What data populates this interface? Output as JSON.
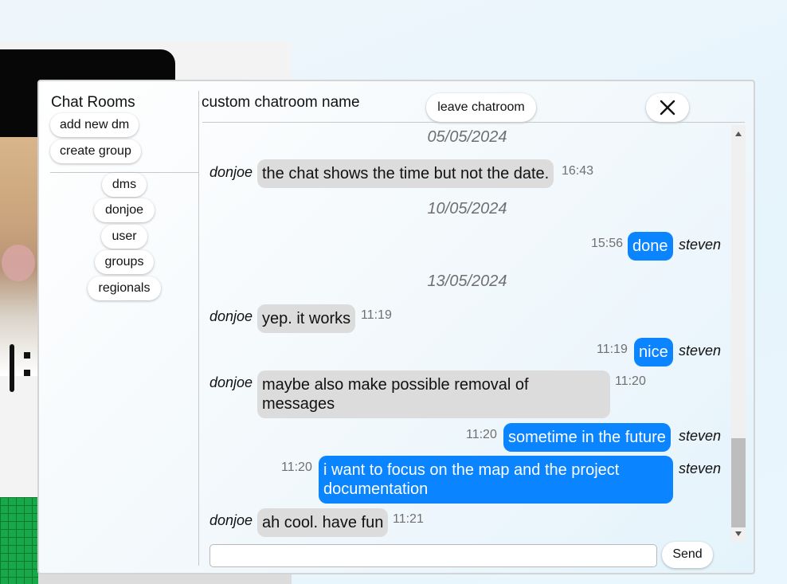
{
  "sidebar": {
    "title": "Chat Rooms",
    "add_dm_label": "add new dm",
    "create_group_label": "create group",
    "items": [
      {
        "label": "dms"
      },
      {
        "label": "donjoe"
      },
      {
        "label": "user"
      },
      {
        "label": "groups"
      },
      {
        "label": "regionals"
      }
    ]
  },
  "header": {
    "room_name": "custom chatroom name",
    "leave_label": "leave chatroom",
    "close_icon": "close-icon"
  },
  "messages": {
    "dates": [
      "05/05/2024",
      "10/05/2024",
      "13/05/2024"
    ],
    "items": [
      {
        "sender": "donjoe",
        "text": "the chat shows the time but not the date.",
        "time": "16:43",
        "direction": "incoming"
      },
      {
        "sender": "steven",
        "text": "done",
        "time": "15:56",
        "direction": "outgoing"
      },
      {
        "sender": "donjoe",
        "text": "yep. it works",
        "time": "11:19",
        "direction": "incoming"
      },
      {
        "sender": "steven",
        "text": "nice",
        "time": "11:19",
        "direction": "outgoing"
      },
      {
        "sender": "donjoe",
        "text": "maybe also make possible removal of messages",
        "time": "11:20",
        "direction": "incoming"
      },
      {
        "sender": "steven",
        "text": "sometime in the future",
        "time": "11:20",
        "direction": "outgoing"
      },
      {
        "sender": "steven",
        "text": "i want to focus on the map and the project documentation",
        "time": "11:20",
        "direction": "outgoing"
      },
      {
        "sender": "donjoe",
        "text": "ah cool. have fun",
        "time": "11:21",
        "direction": "incoming"
      }
    ]
  },
  "composer": {
    "input_value": "",
    "input_placeholder": "",
    "send_label": "Send"
  },
  "colors": {
    "outgoing_bubble": "#0a84ff",
    "incoming_bubble": "#dcdcdc",
    "date_text": "#6f6f6f"
  }
}
